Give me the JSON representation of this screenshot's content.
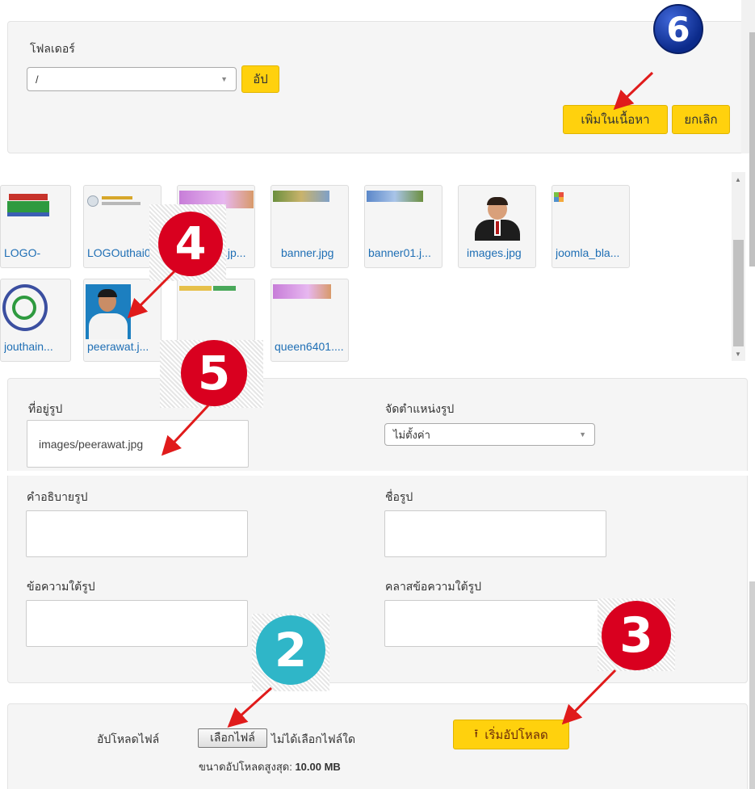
{
  "folder": {
    "label": "โฟลเดอร์",
    "select_value": "/",
    "up_button": "อัป",
    "insert_button": "เพิ่มในเนื้อหา",
    "cancel_button": "ยกเลิก"
  },
  "thumbnails": [
    {
      "name": "LOGO-"
    },
    {
      "name": "LOGOuthai0"
    },
    {
      "name": ".jp..."
    },
    {
      "name": "banner.jpg"
    },
    {
      "name": "banner01.j..."
    },
    {
      "name": "images.jpg"
    },
    {
      "name": "joomla_bla..."
    },
    {
      "name": "jouthain..."
    },
    {
      "name": "peerawat.j..."
    },
    {
      "name": ""
    },
    {
      "name": "queen6401...."
    }
  ],
  "image_form": {
    "url_label": "ที่อยู่รูป",
    "url_value": "images/peerawat.jpg",
    "align_label": "จัดตำแหน่งรูป",
    "align_value": "ไม่ตั้งค่า",
    "desc_label": "คำอธิบายรูป",
    "title_label": "ชื่อรูป",
    "caption_label": "ข้อความใต้รูป",
    "caption_class_label": "คลาสข้อความใต้รูป"
  },
  "upload": {
    "label": "อัปโหลดไฟล์",
    "choose_button": "เลือกไฟล์",
    "no_file_text": "ไม่ได้เลือกไฟล์ใด",
    "max_size_label": "ขนาดอัปโหลดสูงสุด:",
    "max_size_value": "10.00 MB",
    "start_button": "เริ่มอัปโหลด"
  },
  "annotations": {
    "n2": "2",
    "n3": "3",
    "n4": "4",
    "n5": "5",
    "n6": "6"
  },
  "colors": {
    "accent_yellow": "#ffd10d",
    "link_blue": "#1f6fb5",
    "marker_red": "#d9001f",
    "marker_teal": "#2fb6c8",
    "marker_navy": "#0b2a8a"
  }
}
